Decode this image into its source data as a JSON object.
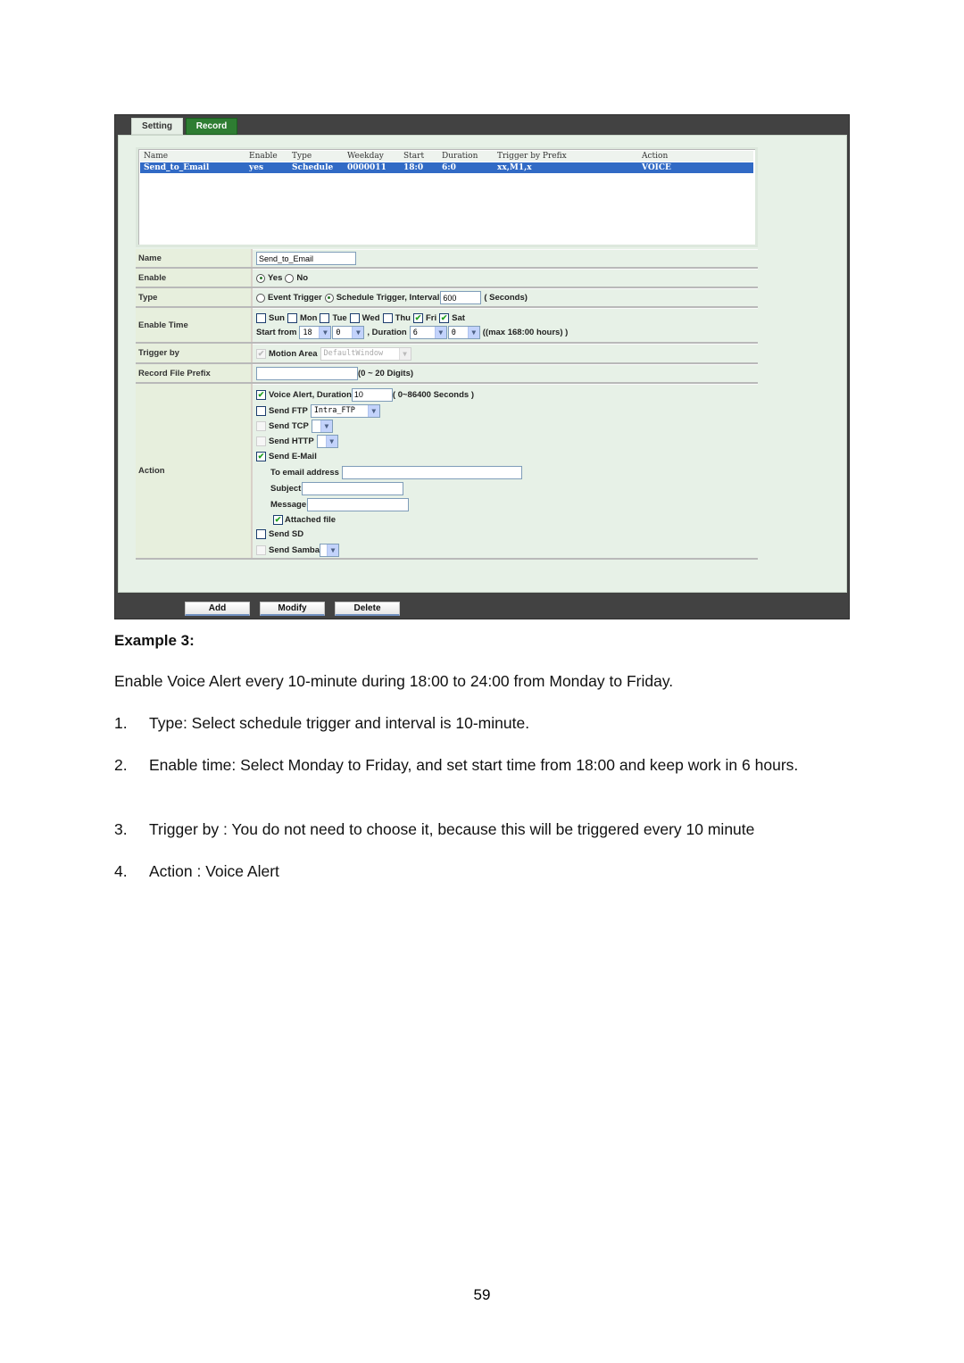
{
  "tabs": [
    "Setting",
    "Record"
  ],
  "active_tab": "Record",
  "record_list": {
    "columns": [
      "Name",
      "Enable",
      "Type",
      "Weekday",
      "Start",
      "Duration",
      "Trigger by Prefix",
      "Action"
    ],
    "rows": [
      {
        "name": "Send_to_Email",
        "enable": "yes",
        "type": "Schedule",
        "weekday": "0000011",
        "start": "18:0",
        "duration": "6:0",
        "trigger_prefix": "xx,M1,x",
        "action": "VOICE"
      }
    ]
  },
  "form": {
    "name": {
      "label": "Name",
      "value": "Send_to_Email"
    },
    "enable": {
      "label": "Enable",
      "options": [
        "Yes",
        "No"
      ],
      "selected": "Yes"
    },
    "type": {
      "label": "Type",
      "options": [
        "Event Trigger",
        "Schedule Trigger, Interval"
      ],
      "selected": "Schedule Trigger, Interval",
      "interval": "600",
      "unit": "( Seconds)"
    },
    "enable_time": {
      "label": "Enable Time",
      "days": [
        {
          "label": "Sun",
          "checked": false
        },
        {
          "label": "Mon",
          "checked": false
        },
        {
          "label": "Tue",
          "checked": false
        },
        {
          "label": "Wed",
          "checked": false
        },
        {
          "label": "Thu",
          "checked": false
        },
        {
          "label": "Fri",
          "checked": true
        },
        {
          "label": "Sat",
          "checked": true
        }
      ],
      "start_from_label": "Start from",
      "start_hour": "18",
      "start_min": "0",
      "duration_label": ", Duration",
      "duration_hour": "6",
      "duration_min": "0",
      "max_note": "((max 168:00 hours) )"
    },
    "trigger_by": {
      "label": "Trigger by",
      "motion_area_label": "Motion Area",
      "motion_area_checked": true,
      "window": "DefaultWindow"
    },
    "record_prefix": {
      "label": "Record File Prefix",
      "value": "",
      "hint": "(0 ~ 20 Digits)"
    },
    "action": {
      "label": "Action",
      "voice_alert": {
        "label": "Voice Alert, Duration",
        "checked": true,
        "value": "10",
        "hint": "( 0~86400 Seconds )"
      },
      "send_ftp": {
        "label": "Send FTP",
        "checked": false,
        "value": "Intra_FTP"
      },
      "send_tcp": {
        "label": "Send TCP",
        "checked": false,
        "value": ""
      },
      "send_http": {
        "label": "Send HTTP",
        "checked": false,
        "value": ""
      },
      "send_email": {
        "label": "Send E-Mail",
        "checked": true
      },
      "to_email": {
        "label": "To email address",
        "value": ""
      },
      "subject": {
        "label": "Subject",
        "value": ""
      },
      "message": {
        "label": "Message",
        "value": ""
      },
      "attached_file": {
        "label": "Attached file",
        "checked": true
      },
      "send_sd": {
        "label": "Send SD",
        "checked": false
      },
      "send_samba": {
        "label": "Send Samba",
        "checked": false,
        "value": ""
      }
    }
  },
  "buttons": {
    "add": "Add",
    "modify": "Modify",
    "delete": "Delete"
  },
  "doc": {
    "heading": "Example 3:",
    "intro": "Enable Voice Alert every 10-minute during 18:00 to 24:00 from Monday to Friday.",
    "steps": [
      {
        "num": "1.",
        "text": "Type: Select schedule trigger and interval is 10-minute."
      },
      {
        "num": "2.",
        "text": "Enable time: Select Monday to Friday, and set start time from 18:00 and keep work in 6 hours."
      },
      {
        "num": "3.",
        "text": "Trigger by : You do not need to choose it, because this will be triggered every 10 minute"
      },
      {
        "num": "4.",
        "text": "Action : Voice Alert"
      }
    ],
    "page_number": "59"
  }
}
